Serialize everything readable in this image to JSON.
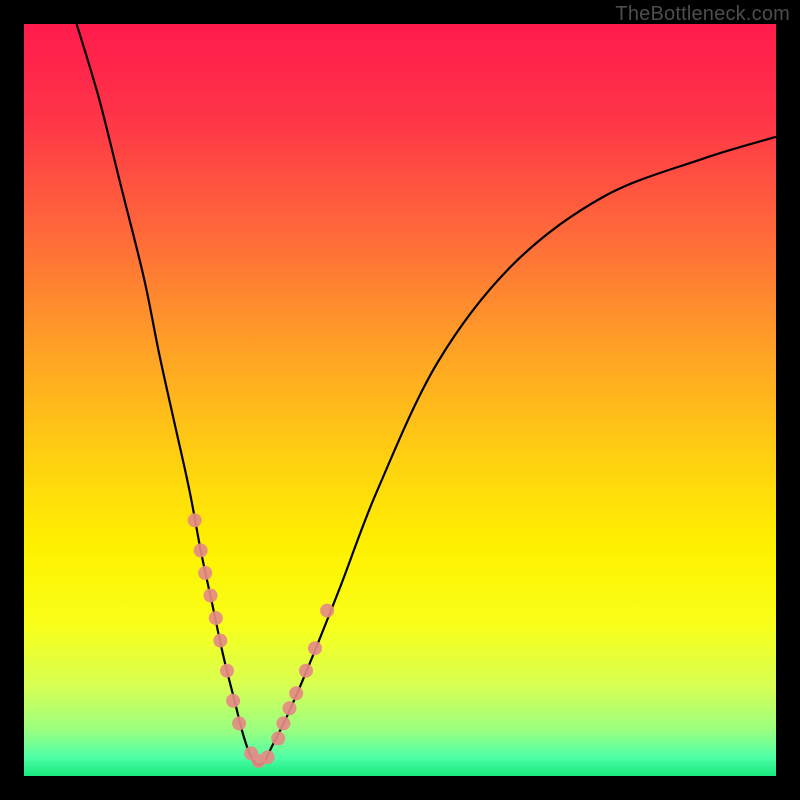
{
  "watermark": "TheBottleneck.com",
  "gradient_stops": [
    {
      "offset": 0.0,
      "color": "#ff1b4c"
    },
    {
      "offset": 0.12,
      "color": "#ff3348"
    },
    {
      "offset": 0.28,
      "color": "#ff6a3a"
    },
    {
      "offset": 0.44,
      "color": "#ffa425"
    },
    {
      "offset": 0.58,
      "color": "#ffd110"
    },
    {
      "offset": 0.7,
      "color": "#fff200"
    },
    {
      "offset": 0.8,
      "color": "#f8ff1a"
    },
    {
      "offset": 0.88,
      "color": "#d8ff53"
    },
    {
      "offset": 0.94,
      "color": "#99ff80"
    },
    {
      "offset": 0.975,
      "color": "#4fffa8"
    },
    {
      "offset": 1.0,
      "color": "#17e87d"
    }
  ],
  "chart_data": {
    "type": "line",
    "title": "",
    "xlabel": "",
    "ylabel": "",
    "xlim": [
      0,
      100
    ],
    "ylim": [
      0,
      100
    ],
    "series": [
      {
        "name": "bottleneck-curve",
        "color": "#000000",
        "x": [
          7,
          10,
          13,
          16,
          18,
          20,
          22,
          23.5,
          25,
          26.5,
          28,
          29,
          30,
          31,
          32,
          33,
          35,
          38,
          42,
          47,
          55,
          65,
          77,
          90,
          100
        ],
        "y": [
          100,
          90,
          78,
          66,
          56,
          47,
          38,
          30,
          23,
          16,
          10,
          6,
          3,
          1.5,
          2,
          4,
          8,
          15,
          25,
          38,
          55,
          68,
          77,
          82,
          85
        ]
      }
    ],
    "markers": {
      "name": "highlight-points",
      "color": "#e48b84",
      "radius_px": 7,
      "x": [
        22.7,
        23.5,
        24.1,
        24.8,
        25.5,
        26.1,
        27.0,
        27.8,
        28.6,
        30.2,
        31.2,
        32.4,
        33.8,
        34.5,
        35.3,
        36.2,
        37.5,
        38.7,
        40.3
      ],
      "y": [
        34,
        30,
        27,
        24,
        21,
        18,
        14,
        10,
        7,
        3,
        2,
        2.5,
        5,
        7,
        9,
        11,
        14,
        17,
        22
      ]
    }
  }
}
